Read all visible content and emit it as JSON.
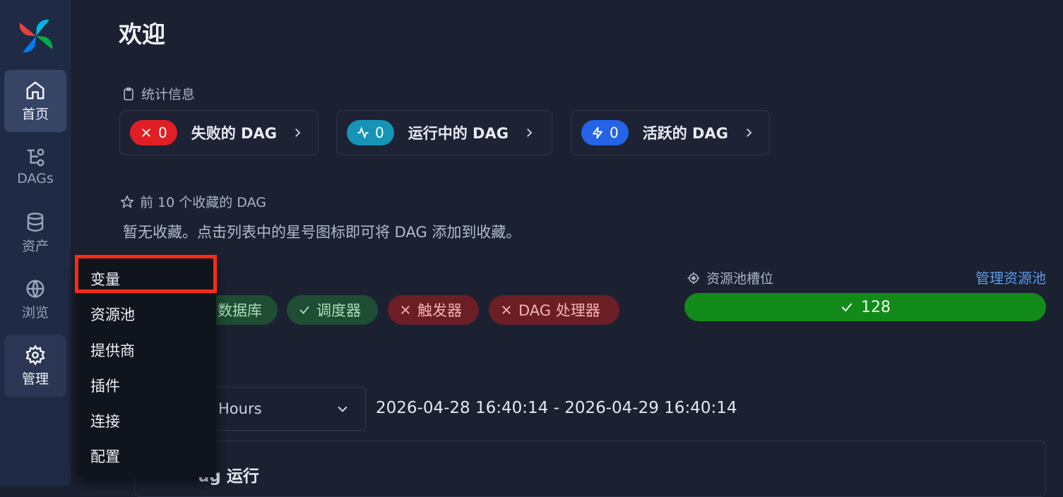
{
  "sidebar": {
    "items": [
      {
        "label": "首页",
        "icon": "home-icon"
      },
      {
        "label": "DAGs",
        "icon": "dags-icon"
      },
      {
        "label": "资产",
        "icon": "database-icon"
      },
      {
        "label": "浏览",
        "icon": "globe-icon"
      },
      {
        "label": "管理",
        "icon": "gear-icon"
      }
    ]
  },
  "page": {
    "title": "欢迎"
  },
  "stats": {
    "section_label": "统计信息",
    "cards": [
      {
        "count": "0",
        "label": "失败的 DAG",
        "color": "#e01f24"
      },
      {
        "count": "0",
        "label": "运行中的 DAG",
        "color": "#1694b8"
      },
      {
        "count": "0",
        "label": "活跃的 DAG",
        "color": "#2563e8"
      }
    ]
  },
  "favorites": {
    "section_label": "前 10 个收藏的 DAG",
    "empty_text": "暂无收藏。点击列表中的星号图标即可将 DAG 添加到收藏。"
  },
  "health": {
    "items": [
      {
        "label": "数据库",
        "status": "ok"
      },
      {
        "label": "调度器",
        "status": "ok"
      },
      {
        "label": "触发器",
        "status": "bad"
      },
      {
        "label": "DAG 处理器",
        "status": "bad"
      }
    ]
  },
  "pool": {
    "section_label": "资源池槽位",
    "manage_link": "管理资源池",
    "value": "128",
    "color": "#128a1a"
  },
  "time": {
    "select_value": "Hours",
    "range": "2026-04-28 16:40:14 - 2026-04-29 16:40:14"
  },
  "runs": {
    "title": "ug 运行"
  },
  "admin_menu": {
    "items": [
      "变量",
      "资源池",
      "提供商",
      "插件",
      "连接",
      "配置"
    ]
  }
}
